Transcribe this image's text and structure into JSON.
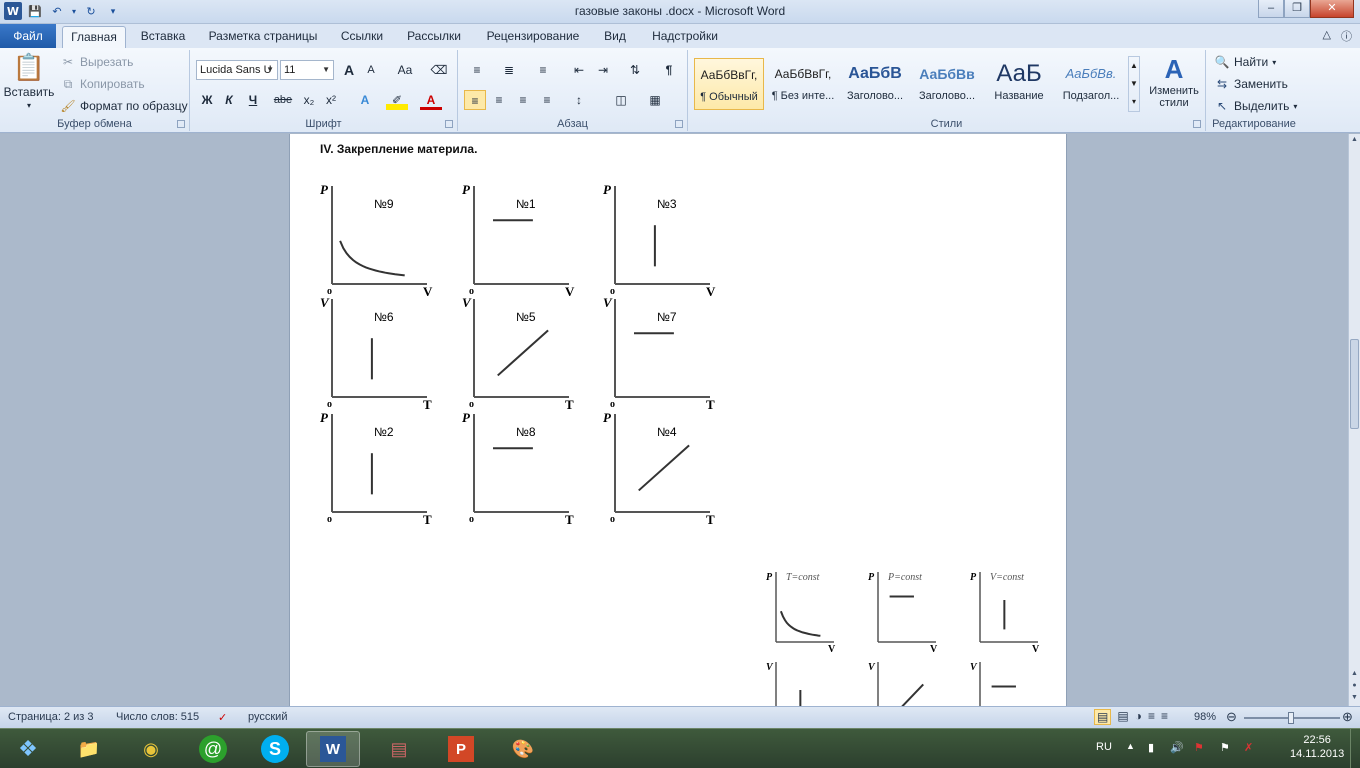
{
  "window": {
    "title": "газовые законы .docx  -  Microsoft Word",
    "app_badge": "W"
  },
  "tabs": {
    "file": "Файл",
    "items": [
      "Главная",
      "Вставка",
      "Разметка страницы",
      "Ссылки",
      "Рассылки",
      "Рецензирование",
      "Вид",
      "Надстройки"
    ],
    "active": "Главная"
  },
  "ribbon": {
    "clipboard": {
      "paste": "Вставить",
      "cut": "Вырезать",
      "copy": "Копировать",
      "format_painter": "Формат по образцу",
      "label": "Буфер обмена"
    },
    "font": {
      "name": "Lucida Sans U",
      "size": "11",
      "label": "Шрифт",
      "bold": "Ж",
      "italic": "К",
      "underline": "Ч",
      "strike": "abe",
      "grow": "A",
      "shrink": "A",
      "case": "Aa"
    },
    "paragraph": {
      "label": "Абзац"
    },
    "styles": {
      "label": "Стили",
      "items": [
        {
          "sample": "АаБбВвГг,",
          "name": "¶ Обычный"
        },
        {
          "sample": "АаБбВвГг,",
          "name": "¶ Без инте..."
        },
        {
          "sample": "АаБбВ",
          "name": "Заголово..."
        },
        {
          "sample": "АаБбВв",
          "name": "Заголово..."
        },
        {
          "sample": "АаБ",
          "name": "Название"
        },
        {
          "sample": "АаБбВв.",
          "name": "Подзагол..."
        }
      ],
      "change": "Изменить стили"
    },
    "editing": {
      "label": "Редактирование",
      "find": "Найти",
      "replace": "Заменить",
      "select": "Выделить"
    }
  },
  "document": {
    "heading": "IV. Закрепление материла.",
    "graphs": [
      {
        "num": "№9",
        "y": "P",
        "x": "V",
        "kind": "hyperbola"
      },
      {
        "num": "№1",
        "y": "P",
        "x": "V",
        "kind": "horizontal"
      },
      {
        "num": "№3",
        "y": "P",
        "x": "V",
        "kind": "vertical"
      },
      {
        "num": "№6",
        "y": "V",
        "x": "T",
        "kind": "vertical"
      },
      {
        "num": "№5",
        "y": "V",
        "x": "T",
        "kind": "diagonal"
      },
      {
        "num": "№7",
        "y": "V",
        "x": "T",
        "kind": "horizontal"
      },
      {
        "num": "№2",
        "y": "P",
        "x": "T",
        "kind": "vertical"
      },
      {
        "num": "№8",
        "y": "P",
        "x": "T",
        "kind": "horizontal"
      },
      {
        "num": "№4",
        "y": "P",
        "x": "T",
        "kind": "diagonal"
      }
    ],
    "origin": "o",
    "small_graphs": [
      {
        "title": "T=const",
        "y": "P",
        "x": "V",
        "kind": "hyperbola"
      },
      {
        "title": "P=const",
        "y": "P",
        "x": "V",
        "kind": "horizontal"
      },
      {
        "title": "V=const",
        "y": "P",
        "x": "V",
        "kind": "vertical"
      },
      {
        "title": "",
        "y": "V",
        "x": "",
        "kind": "vertical"
      },
      {
        "title": "",
        "y": "V",
        "x": "",
        "kind": "diagonal"
      },
      {
        "title": "",
        "y": "V",
        "x": "",
        "kind": "horizontal"
      }
    ]
  },
  "status": {
    "page": "Страница: 2 из 3",
    "words": "Число слов: 515",
    "lang": "русский",
    "zoom": "98%",
    "zoom_level_pct": 98
  },
  "taskbar": {
    "lang": "RU",
    "time": "22:56",
    "date": "14.11.2013"
  }
}
